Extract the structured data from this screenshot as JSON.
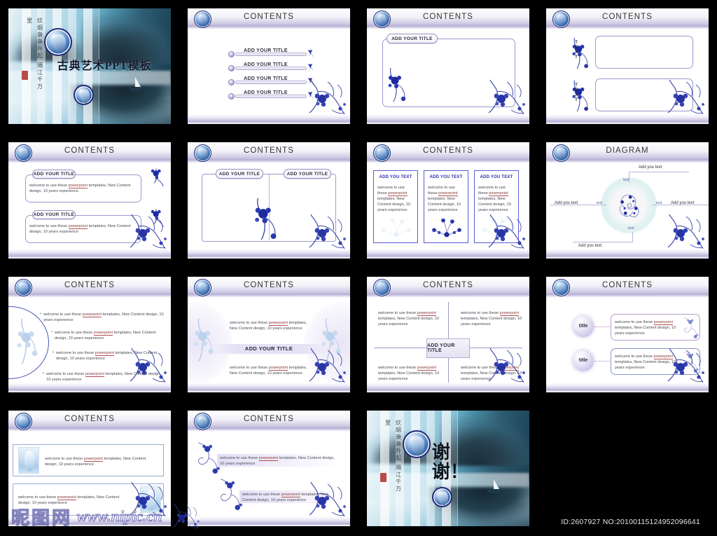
{
  "meta": {
    "id_line": "ID:2607927 NO:20100115124952096641",
    "watermark_cn": "昵图网",
    "watermark_url": "www.nipic.cn",
    "accent_blue": "#1e2a78",
    "accent_purple": "#b4aed4",
    "link_red": "#8b3a3a"
  },
  "common": {
    "contents_title": "CONTENTS",
    "diagram_title": "DIAGRAM",
    "add_your_title": "ADD YOUR TITLE",
    "add_you_text": "ADD YOU TEXT",
    "add_you_text_label": "Add you text",
    "text_label": "text",
    "text_vertical": "TEXT",
    "title_small": "title",
    "body_prefix": "welcome to use these ",
    "body_link": "powerpoint",
    "body_suffix": " templates, New Content design, 10 years experience"
  },
  "slides": [
    {
      "n": 1,
      "type": "cover",
      "title": "古典艺术PPT模板",
      "calligraphy": "炊烟袅袅升起 隔江千万里",
      "seal": true
    },
    {
      "n": 2,
      "type": "bullet-bars",
      "title": "CONTENTS",
      "items": [
        "ADD YOUR TITLE",
        "ADD YOUR TITLE",
        "ADD YOUR TITLE",
        "ADD YOUR TITLE"
      ]
    },
    {
      "n": 3,
      "type": "single-box",
      "title": "CONTENTS",
      "box_label": "ADD YOUR TITLE"
    },
    {
      "n": 4,
      "type": "two-vertical-text",
      "title": "CONTENTS",
      "labels": [
        "TEXT",
        "TEXT"
      ]
    },
    {
      "n": 5,
      "type": "two-stacked-boxes",
      "title": "CONTENTS",
      "blocks": [
        {
          "label": "ADD YOUR TITLE",
          "body": "welcome to use these powerpoint templates, New Content design, 10 years experience"
        },
        {
          "label": "ADD YOUR TITLE",
          "body": "welcome to use these powerpoint templates, New Content design, 10 years experience"
        }
      ]
    },
    {
      "n": 6,
      "type": "two-column-empty",
      "title": "CONTENTS",
      "labels": [
        "ADD YOUR TITLE",
        "ADD YOUR TITLE"
      ]
    },
    {
      "n": 7,
      "type": "three-columns",
      "title": "CONTENTS",
      "columns": [
        {
          "header": "ADD YOU TEXT",
          "body": "welcome to use these powerpoint templates, New Content design, 10 years experience"
        },
        {
          "header": "ADD YOU TEXT",
          "body": "welcome to use these powerpoint templates, New Content design, 10 years experience"
        },
        {
          "header": "ADD YOU TEXT",
          "body": "welcome to use these powerpoint templates, New Content design, 10 years experience"
        }
      ]
    },
    {
      "n": 8,
      "type": "diagram",
      "title": "DIAGRAM",
      "outer_labels": [
        "Add you text",
        "Add you text",
        "Add you text",
        "Add you text"
      ],
      "inner_labels": [
        "text",
        "text",
        "text",
        "text"
      ]
    },
    {
      "n": 9,
      "type": "bullets",
      "title": "CONTENTS",
      "bullets": [
        "welcome to use these powerpoint templates, New Content design, 10 years experience",
        "welcome to use these powerpoint templates, New Content design, 10 years experience",
        "welcome to use these powerpoint templates, New Content design, 10 years experience",
        "welcome to use these powerpoint templates, New Content design, 10 years experience"
      ]
    },
    {
      "n": 10,
      "type": "center-band",
      "title": "CONTENTS",
      "top_body": "welcome to use these powerpoint templates, New Content design, 10 years experience",
      "band_label": "ADD YOUR TITLE",
      "bottom_body": "welcome to use these powerpoint templates, New Content design, 10 years experience"
    },
    {
      "n": 11,
      "type": "quadrants",
      "title": "CONTENTS",
      "center_label": "ADD YOUR TITLE",
      "quadrants": [
        "welcome to use these powerpoint templates, New Content design, 10 years experience",
        "welcome to use these powerpoint templates, New Content design, 10 years experience",
        "welcome to use these powerpoint templates, New Content design, 10 years experience",
        "welcome to use these powerpoint templates, New Content design, 10 years experience"
      ]
    },
    {
      "n": 12,
      "type": "title-circles",
      "title": "CONTENTS",
      "rows": [
        {
          "circle": "title",
          "body": "welcome to use these powerpoint templates, New Content design, 10 years experience"
        },
        {
          "circle": "title",
          "body": "welcome to use these powerpoint templates, New Content design, 10 years experience"
        }
      ]
    },
    {
      "n": 13,
      "type": "vase-rows",
      "title": "CONTENTS",
      "rows": [
        {
          "image_side": "left",
          "body": "welcome to use these powerpoint templates, New Content design, 10 years experience"
        },
        {
          "image_side": "right",
          "body": "welcome to use these powerpoint templates, New Content design, 10 years experience"
        }
      ]
    },
    {
      "n": 14,
      "type": "floral-rows",
      "title": "CONTENTS",
      "rows": [
        "welcome to use these powerpoint templates, New Content design, 10 years experience",
        "welcome to use these powerpoint templates, New Content design, 10 years experience"
      ]
    },
    {
      "n": 15,
      "type": "thanks",
      "title": "谢谢！",
      "calligraphy": "炊烟袅袅升起 隔江千万里"
    },
    {
      "n": 16,
      "type": "blank"
    }
  ]
}
